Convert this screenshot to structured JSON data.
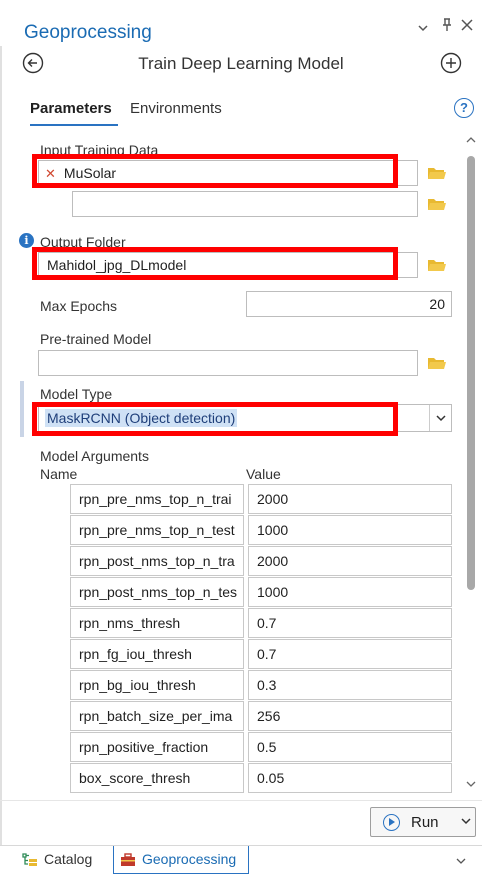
{
  "pane": {
    "title": "Geoprocessing",
    "tool_title": "Train Deep Learning Model",
    "controls": {
      "menu": "⌄",
      "pin": "ᵖ",
      "close": "✕"
    }
  },
  "tabs": {
    "parameters": "Parameters",
    "environments": "Environments",
    "help": "?"
  },
  "params": {
    "input_training_data": {
      "label": "Input Training Data",
      "value": "MuSolar",
      "empty_value": ""
    },
    "output_folder": {
      "label": "Output Folder",
      "value": "Mahidol_jpg_DLmodel"
    },
    "max_epochs": {
      "label": "Max Epochs",
      "value": "20"
    },
    "pretrained_model": {
      "label": "Pre-trained Model",
      "value": ""
    },
    "model_type": {
      "label": "Model Type",
      "value": "MaskRCNN (Object detection)"
    },
    "model_arguments": {
      "label": "Model Arguments",
      "col_name": "Name",
      "col_value": "Value",
      "rows": [
        {
          "name": "rpn_pre_nms_top_n_trai",
          "value": "2000"
        },
        {
          "name": "rpn_pre_nms_top_n_test",
          "value": "1000"
        },
        {
          "name": "rpn_post_nms_top_n_tra",
          "value": "2000"
        },
        {
          "name": "rpn_post_nms_top_n_tes",
          "value": "1000"
        },
        {
          "name": "rpn_nms_thresh",
          "value": "0.7"
        },
        {
          "name": "rpn_fg_iou_thresh",
          "value": "0.7"
        },
        {
          "name": "rpn_bg_iou_thresh",
          "value": "0.3"
        },
        {
          "name": "rpn_batch_size_per_ima",
          "value": "256"
        },
        {
          "name": "rpn_positive_fraction",
          "value": "0.5"
        },
        {
          "name": "box_score_thresh",
          "value": "0.05"
        }
      ]
    }
  },
  "run": {
    "label": "Run"
  },
  "bottom_tabs": {
    "catalog": "Catalog",
    "geoprocessing": "Geoprocessing"
  },
  "colors": {
    "accent": "#1a6bb3",
    "highlight": "#ff0000",
    "folder": "#e8b931"
  }
}
